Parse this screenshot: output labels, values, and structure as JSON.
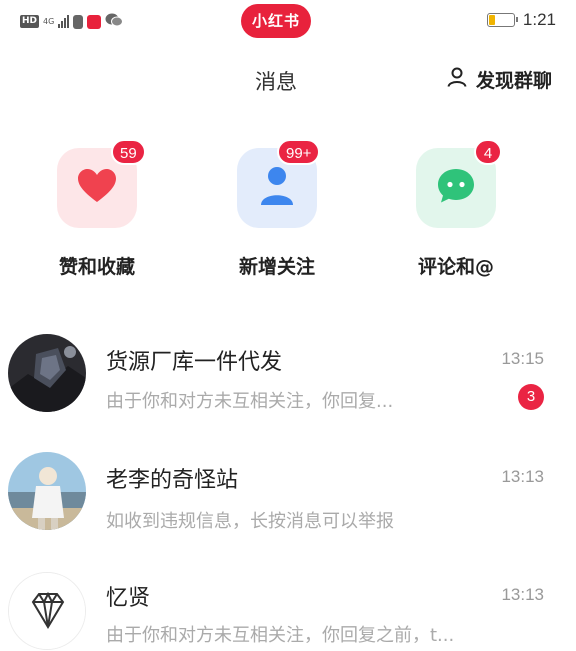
{
  "status_bar": {
    "hd": "HD",
    "network": "4G",
    "app_logo": "小红书",
    "time": "1:21",
    "battery_level": 0.25,
    "battery_color": "#f0b400"
  },
  "header": {
    "title": "消息",
    "discover_icon": "person-icon",
    "discover_label": "发现群聊"
  },
  "categories": [
    {
      "label": "赞和收藏",
      "badge": "59",
      "icon": "heart-icon",
      "tile_color": "#fde6e8",
      "icon_color": "#f0424f"
    },
    {
      "label": "新增关注",
      "badge": "99+",
      "icon": "person-icon",
      "tile_color": "#e3ecfb",
      "icon_color": "#3d86ee"
    },
    {
      "label": "评论和@",
      "badge": "4",
      "icon": "chat-bubble-icon",
      "tile_color": "#e2f6ec",
      "icon_color": "#2fc37a"
    }
  ],
  "messages": [
    {
      "name": "货源厂库一件代发",
      "time": "13:15",
      "preview": "由于你和对方未互相关注，你回复...",
      "unread": "3"
    },
    {
      "name": "老李的奇怪站",
      "time": "13:13",
      "preview": "如收到违规信息，长按消息可以举报",
      "unread": ""
    },
    {
      "name": "忆贤",
      "time": "13:13",
      "preview": "由于你和对方未互相关注，你回复之前，t...",
      "unread": ""
    }
  ],
  "colors": {
    "brand": "#e8223c",
    "badge": "#ea2443"
  }
}
